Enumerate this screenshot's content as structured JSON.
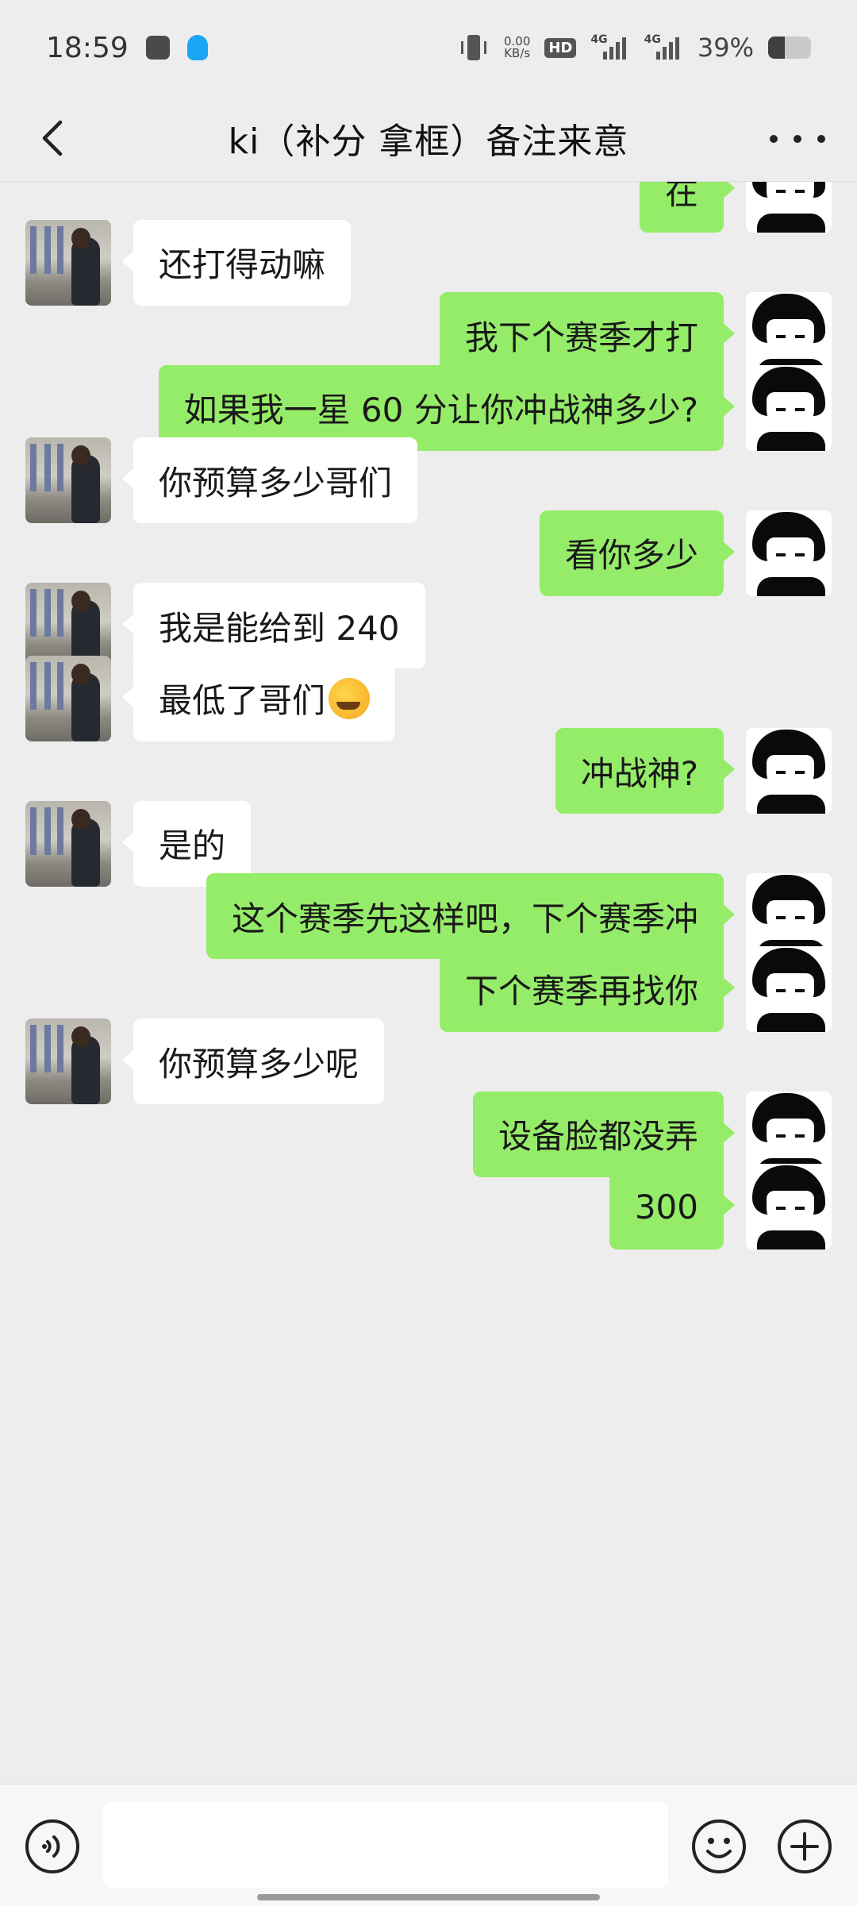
{
  "status_bar": {
    "time": "18:59",
    "net_speed_value": "0.00",
    "net_speed_unit": "KB/s",
    "hd_label": "HD",
    "signal1_label": "4G",
    "signal2_label": "4G",
    "battery_percent_text": "39%",
    "battery_level": 0.39
  },
  "header": {
    "title": "ki（补分  拿框）备注来意"
  },
  "messages": [
    {
      "side": "right",
      "text": "在"
    },
    {
      "side": "left",
      "text": "还打得动嘛"
    },
    {
      "side": "right",
      "text": "我下个赛季才打"
    },
    {
      "side": "right",
      "text": "如果我一星 60 分让你冲战神多少?"
    },
    {
      "side": "left",
      "text": "你预算多少哥们"
    },
    {
      "side": "right",
      "text": "看你多少"
    },
    {
      "side": "left",
      "text": "我是能给到 240"
    },
    {
      "side": "left",
      "text": "最低了哥们",
      "emoji": "crying-laughing-emoji"
    },
    {
      "side": "right",
      "text": "冲战神?"
    },
    {
      "side": "left",
      "text": "是的"
    },
    {
      "side": "right",
      "text": "这个赛季先这样吧，下个赛季冲"
    },
    {
      "side": "right",
      "text": "下个赛季再找你"
    },
    {
      "side": "left",
      "text": "你预算多少呢"
    },
    {
      "side": "right",
      "text": "设备脸都没弄"
    },
    {
      "side": "right",
      "text": "300"
    }
  ],
  "input_bar": {
    "placeholder": "",
    "value": ""
  }
}
